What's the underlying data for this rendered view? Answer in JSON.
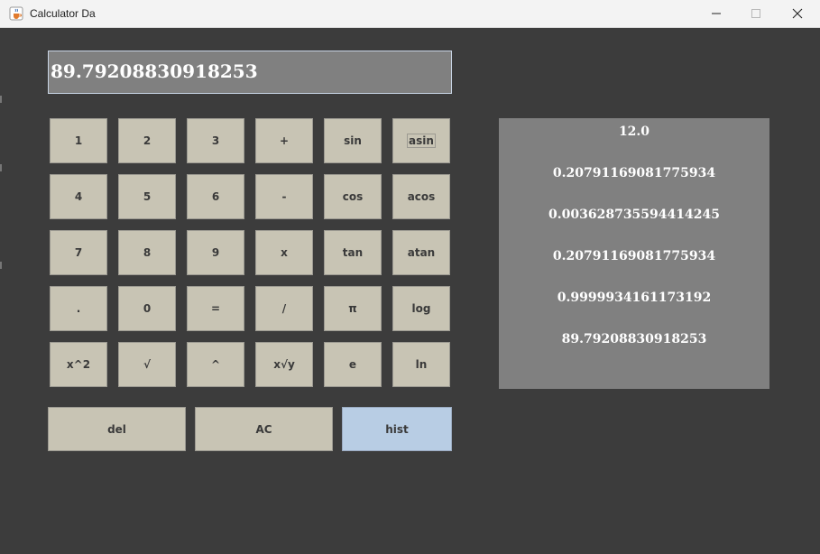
{
  "window": {
    "title": "Calculator Da",
    "icon": "java-cup-icon",
    "controls": [
      "minimize-icon",
      "maximize-icon",
      "close-icon"
    ]
  },
  "display": {
    "value": "89.79208830918253"
  },
  "keypad": {
    "rows": [
      [
        "1",
        "2",
        "3",
        "+",
        "sin",
        "asin"
      ],
      [
        "4",
        "5",
        "6",
        "-",
        "cos",
        "acos"
      ],
      [
        "7",
        "8",
        "9",
        "x",
        "tan",
        "atan"
      ],
      [
        ".",
        "0",
        "=",
        "/",
        "π",
        "log"
      ],
      [
        "x^2",
        "√",
        "^",
        "x√y",
        "e",
        "ln"
      ]
    ]
  },
  "actions": {
    "del": "del",
    "ac": "AC",
    "hist": "hist"
  },
  "history": {
    "items": [
      "12.0",
      "0.20791169081775934",
      "0.003628735594414245",
      "0.20791169081775934",
      "0.9999934161173192",
      "89.79208830918253"
    ]
  },
  "colors": {
    "background": "#3c3c3c",
    "display": "#808080",
    "key": "#c8c4b4",
    "key_active": "#b8cde4",
    "history_panel": "#808080",
    "text_light": "#ffffff"
  }
}
